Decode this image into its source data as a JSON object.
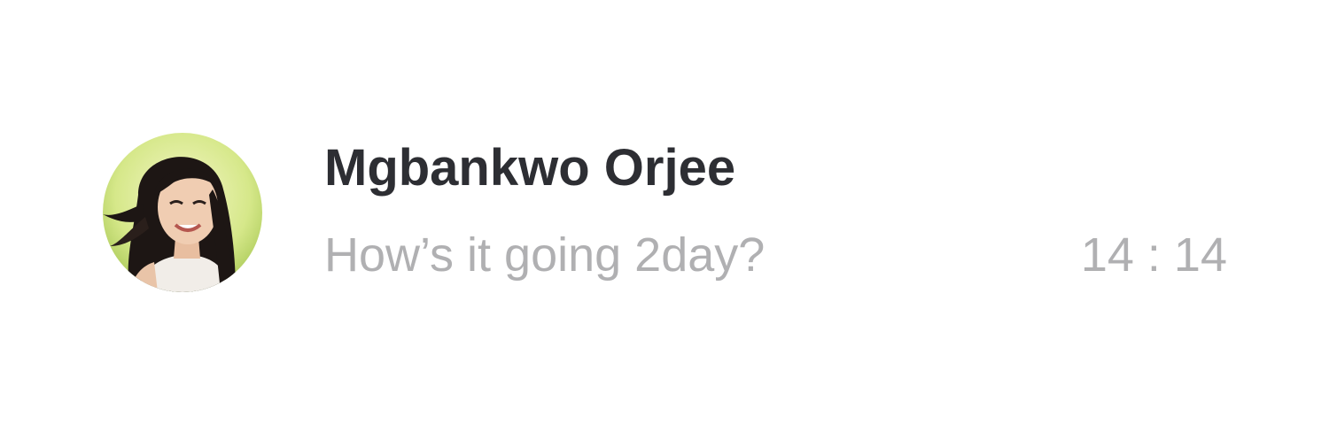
{
  "conversation": {
    "avatar_icon": "user-photo-avatar",
    "contact_name": "Mgbankwo Orjee",
    "last_message": "How’s it going 2day?",
    "time": "14 : 14"
  },
  "colors": {
    "name": "#2d2e33",
    "secondary_text": "#b0b0b2",
    "background": "#ffffff"
  }
}
